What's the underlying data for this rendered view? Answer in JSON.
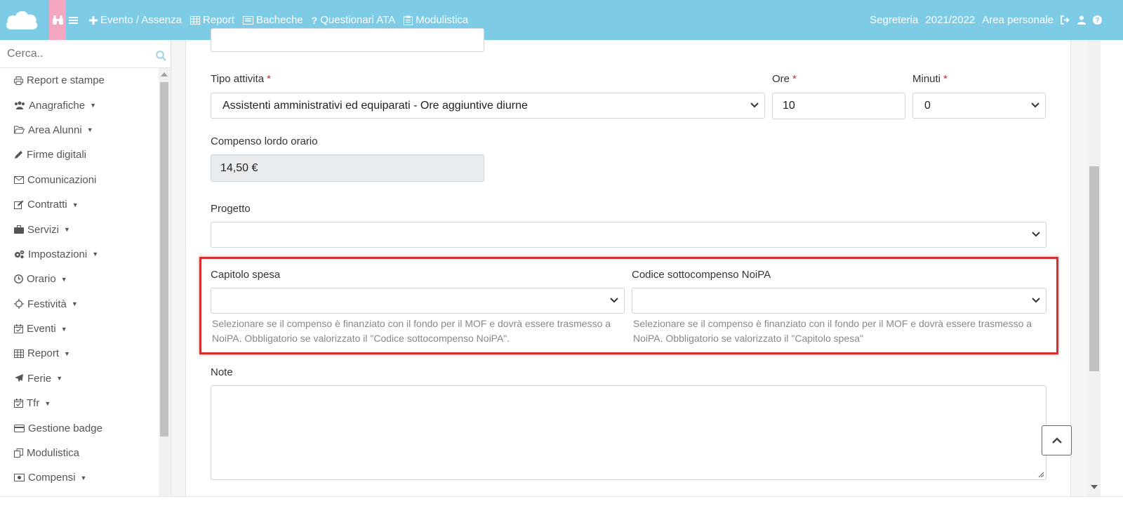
{
  "topbar": {
    "nav": [
      {
        "label": "Evento / Assenza",
        "icon": "plus-icon"
      },
      {
        "label": "Report",
        "icon": "table-icon"
      },
      {
        "label": "Bacheche",
        "icon": "board-icon"
      },
      {
        "label": "Questionari ATA",
        "icon": "question-icon"
      },
      {
        "label": "Modulistica",
        "icon": "forms-icon"
      }
    ],
    "right": {
      "office": "Segreteria",
      "year": "2021/2022",
      "personal": "Area personale"
    }
  },
  "sidebar": {
    "search_placeholder": "Cerca..",
    "items": [
      {
        "label": "Report e stampe",
        "caret": false
      },
      {
        "label": "Anagrafiche",
        "caret": true
      },
      {
        "label": "Area Alunni",
        "caret": true
      },
      {
        "label": "Firme digitali",
        "caret": false
      },
      {
        "label": "Comunicazioni",
        "caret": false
      },
      {
        "label": "Contratti",
        "caret": true
      },
      {
        "label": "Servizi",
        "caret": true
      },
      {
        "label": "Impostazioni",
        "caret": true
      },
      {
        "label": "Orario",
        "caret": true
      },
      {
        "label": "Festività",
        "caret": true
      },
      {
        "label": "Eventi",
        "caret": true
      },
      {
        "label": "Report",
        "caret": true
      },
      {
        "label": "Ferie",
        "caret": true
      },
      {
        "label": "Tfr",
        "caret": true
      },
      {
        "label": "Gestione badge",
        "caret": false
      },
      {
        "label": "Modulistica",
        "caret": false
      },
      {
        "label": "Compensi",
        "caret": true
      }
    ],
    "caret_glyph": "▼"
  },
  "form": {
    "tipo_attivita": {
      "label": "Tipo attivita",
      "value": "Assistenti amministrativi ed equiparati - Ore aggiuntive diurne"
    },
    "ore": {
      "label": "Ore",
      "value": "10"
    },
    "minuti": {
      "label": "Minuti",
      "value": "0"
    },
    "required_mark": "*",
    "compenso": {
      "label": "Compenso lordo orario",
      "value": "14,50 €"
    },
    "progetto": {
      "label": "Progetto",
      "value": ""
    },
    "capitolo": {
      "label": "Capitolo spesa",
      "value": "",
      "help_line1": "Selezionare se il compenso è finanziato con il fondo per il MOF e dovrà essere trasmesso a",
      "help_line2": "NoiPA. Obbligatorio se valorizzato il \"Codice sottocompenso NoiPA\"."
    },
    "codice": {
      "label": "Codice sottocompenso NoiPA",
      "value": "",
      "help_line1": "Selezionare se il compenso è finanziato con il fondo per il MOF e dovrà essere trasmesso a",
      "help_line2": "NoiPA. Obbligatorio se valorizzato il \"Capitolo spesa\""
    },
    "note": {
      "label": "Note",
      "value": ""
    }
  },
  "colors": {
    "topbar": "#7ecbe6",
    "home": "#f4a7c1",
    "highlight": "#d62f2f",
    "required": "#d9262d"
  }
}
